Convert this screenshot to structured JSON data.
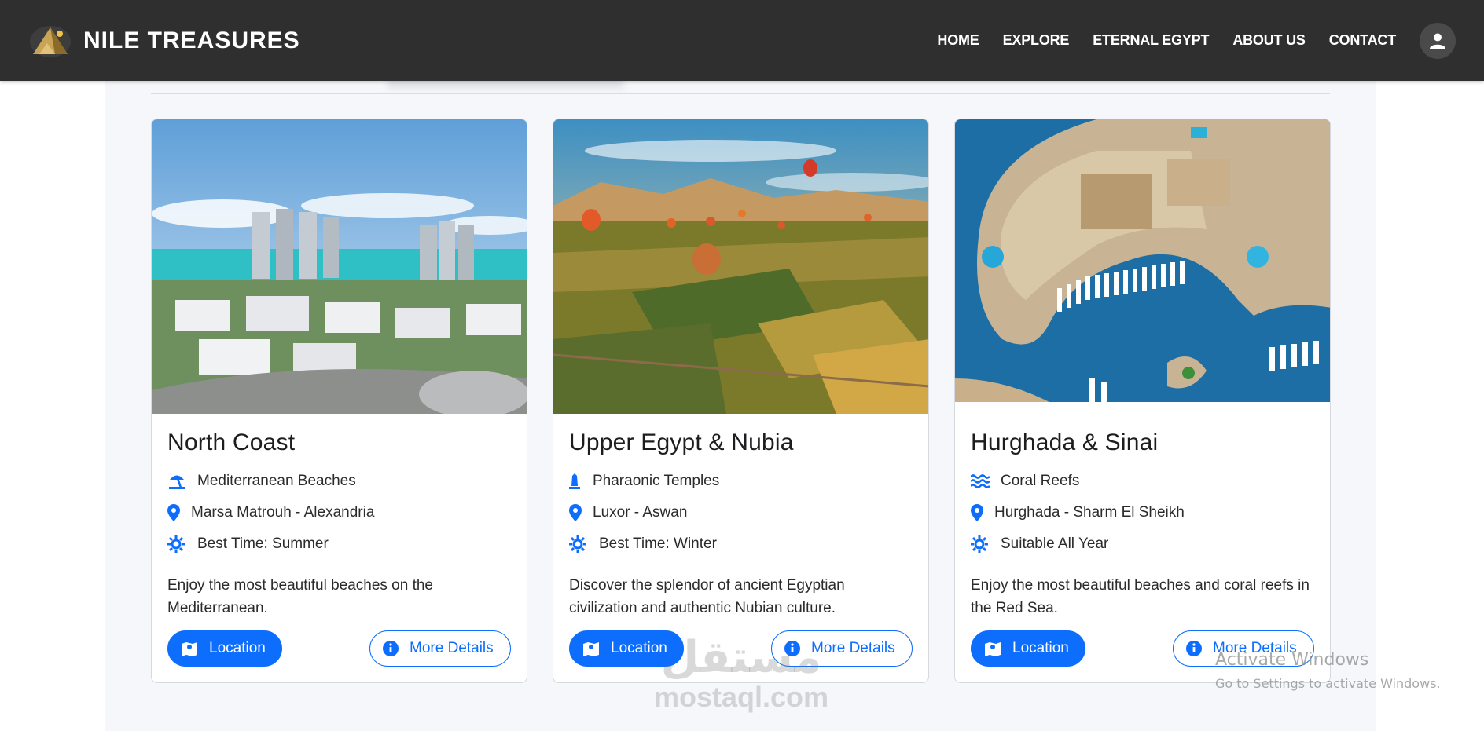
{
  "brand": {
    "name": "NILE TREASURES",
    "logo_icon": "pyramid-logo-icon"
  },
  "nav": {
    "links": [
      "HOME",
      "EXPLORE",
      "ETERNAL EGYPT",
      "ABOUT US",
      "CONTACT"
    ],
    "user_icon": "user-icon"
  },
  "cards": [
    {
      "title": "North Coast",
      "image_icon": "north-coast-photo",
      "rows": [
        {
          "icon": "umbrella-beach-icon",
          "text": "Mediterranean Beaches"
        },
        {
          "icon": "map-pin-icon",
          "text": "Marsa Matrouh - Alexandria"
        },
        {
          "icon": "sun-icon",
          "text": "Best Time: Summer"
        }
      ],
      "description": "Enjoy the most beautiful beaches on the Mediterranean.",
      "location_label": "Location",
      "details_label": "More Details"
    },
    {
      "title": "Upper Egypt & Nubia",
      "image_icon": "upper-egypt-photo",
      "rows": [
        {
          "icon": "monument-icon",
          "text": "Pharaonic Temples"
        },
        {
          "icon": "map-pin-icon",
          "text": "Luxor - Aswan"
        },
        {
          "icon": "sun-icon",
          "text": "Best Time: Winter"
        }
      ],
      "description": "Discover the splendor of ancient Egyptian civilization and authentic Nubian culture.",
      "location_label": "Location",
      "details_label": "More Details"
    },
    {
      "title": "Hurghada & Sinai",
      "image_icon": "hurghada-photo",
      "rows": [
        {
          "icon": "water-waves-icon",
          "text": "Coral Reefs"
        },
        {
          "icon": "map-pin-icon",
          "text": "Hurghada - Sharm El Sheikh"
        },
        {
          "icon": "sun-icon",
          "text": "Suitable All Year"
        }
      ],
      "description": "Enjoy the most beautiful beaches and coral reefs in the Red Sea.",
      "location_label": "Location",
      "details_label": "More Details"
    }
  ],
  "watermarks": {
    "mostaql_ar": "مستقل",
    "mostaql_en": "mostaql.com",
    "windows_line1": "Activate Windows",
    "windows_line2": "Go to Settings to activate Windows."
  },
  "colors": {
    "primary": "#0d6efd",
    "navbar": "#2f2f2f",
    "panel": "#f5f7fa",
    "text": "#1d1d1f"
  }
}
